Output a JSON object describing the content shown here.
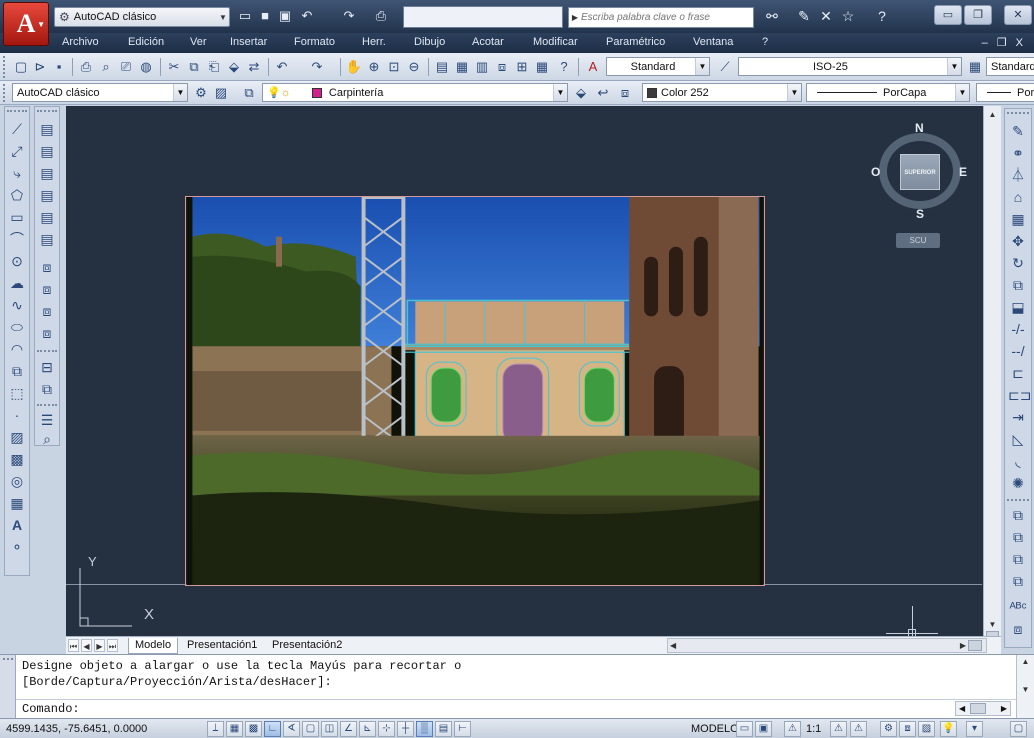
{
  "titlebar": {
    "workspace": "AutoCAD clásico",
    "search_placeholder": "Escriba palabra clave o frase"
  },
  "menubar": {
    "items": [
      "Archivo",
      "Edición",
      "Ver",
      "Insertar",
      "Formato",
      "Herr.",
      "Dibujo",
      "Acotar",
      "Modificar",
      "Paramétrico",
      "Ventana",
      "?"
    ],
    "mdi_controls": "– ❐ X"
  },
  "toolbar_styles": {
    "text_style": "Standard",
    "dim_style": "ISO-25",
    "table_style": "Standard"
  },
  "toolbar_layers": {
    "workspace": "AutoCAD clásico",
    "layer": "Carpintería",
    "color": "Color 252",
    "linetype": "PorCapa",
    "lineweight": "Por"
  },
  "colors": {
    "layer_swatch": "#d0218c",
    "color_swatch": "#3b3b3b",
    "drawing_bg": "#253040"
  },
  "viewcube": {
    "north": "N",
    "south": "S",
    "east": "E",
    "west": "O",
    "face": "SUPERIOR",
    "ucs_button": "SCU"
  },
  "ucs_icon": {
    "x": "X",
    "y": "Y"
  },
  "tabs": {
    "items": [
      "Modelo",
      "Presentación1",
      "Presentación2"
    ],
    "active": "Modelo"
  },
  "command": {
    "history_line1": "Designe objeto a alargar o use la tecla Mayús para recortar o",
    "history_line2": "[Borde/Captura/Proyección/Arista/desHacer]:",
    "prompt": "Comando:"
  },
  "status": {
    "coordinates": "4599.1435, -75.6451, 0.0000",
    "model_label": "MODELO",
    "scale_label": "1:1"
  }
}
